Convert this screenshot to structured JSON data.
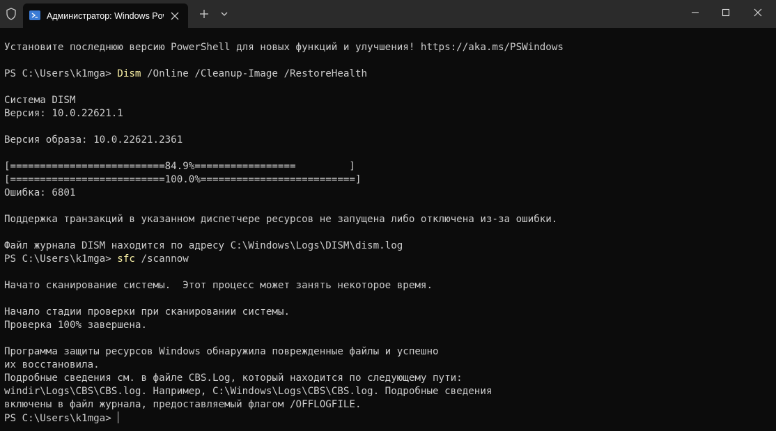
{
  "window": {
    "tab_title": "Администратор: Windows PowerShell"
  },
  "terminal": {
    "banner": "Установите последнюю версию PowerShell для новых функций и улучшения! https://aka.ms/PSWindows",
    "prompt": "PS C:\\Users\\k1mga> ",
    "cmd1_name": "Dism",
    "cmd1_args": " /Online /Cleanup-Image /RestoreHealth",
    "dism_system": "Система DISM",
    "dism_version": "Версия: 10.0.22621.1",
    "image_version": "Версия образа: 10.0.22621.2361",
    "progress1": "[==========================84.9%=================         ]",
    "progress2": "[==========================100.0%==========================]",
    "error": "Ошибка: 6801",
    "tx_error": "Поддержка транзакций в указанном диспетчере ресурсов не запущена либо отключена из-за ошибки.",
    "dism_log": "Файл журнала DISM находится по адресу C:\\Windows\\Logs\\DISM\\dism.log",
    "cmd2_name": "sfc",
    "cmd2_args": " /scannow",
    "scan_start": "Начато сканирование системы.  Этот процесс может занять некоторое время.",
    "verify_start": "Начало стадии проверки при сканировании системы.",
    "verify_done": "Проверка 100% завершена.",
    "wrp_1": "Программа защиты ресурсов Windows обнаружила поврежденные файлы и успешно",
    "wrp_2": "их восстановила.",
    "details_1": "Подробные сведения см. в файле CBS.Log, который находится по следующему пути:",
    "details_2": "windir\\Logs\\CBS\\CBS.log. Например, C:\\Windows\\Logs\\CBS\\CBS.log. Подробные сведения",
    "details_3": "включены в файл журнала, предоставляемый флагом /OFFLOGFILE."
  },
  "colors": {
    "background": "#0c0c0c",
    "titlebar": "#2b2b2b",
    "text": "#cccccc",
    "command": "#f9f1a5"
  },
  "icons": {
    "shield": "shield-icon",
    "powershell": "powershell-icon",
    "close": "close-icon",
    "new_tab": "plus-icon",
    "dropdown": "chevron-down-icon",
    "minimize": "minimize-icon",
    "maximize": "maximize-icon"
  }
}
